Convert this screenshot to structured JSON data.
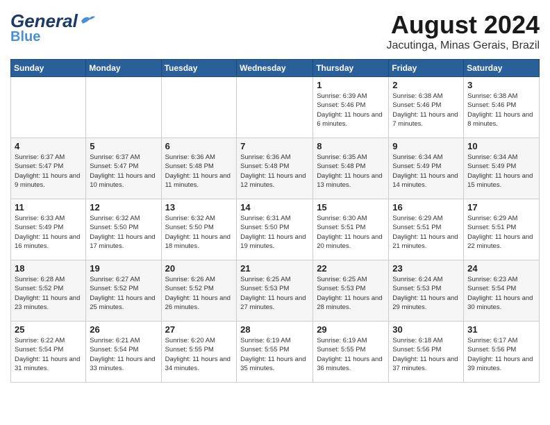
{
  "header": {
    "logo_line1": "General",
    "logo_line2": "Blue",
    "month_year": "August 2024",
    "location": "Jacutinga, Minas Gerais, Brazil"
  },
  "days_of_week": [
    "Sunday",
    "Monday",
    "Tuesday",
    "Wednesday",
    "Thursday",
    "Friday",
    "Saturday"
  ],
  "weeks": [
    [
      {
        "day": "",
        "info": ""
      },
      {
        "day": "",
        "info": ""
      },
      {
        "day": "",
        "info": ""
      },
      {
        "day": "",
        "info": ""
      },
      {
        "day": "1",
        "info": "Sunrise: 6:39 AM\nSunset: 5:46 PM\nDaylight: 11 hours and 6 minutes."
      },
      {
        "day": "2",
        "info": "Sunrise: 6:38 AM\nSunset: 5:46 PM\nDaylight: 11 hours and 7 minutes."
      },
      {
        "day": "3",
        "info": "Sunrise: 6:38 AM\nSunset: 5:46 PM\nDaylight: 11 hours and 8 minutes."
      }
    ],
    [
      {
        "day": "4",
        "info": "Sunrise: 6:37 AM\nSunset: 5:47 PM\nDaylight: 11 hours and 9 minutes."
      },
      {
        "day": "5",
        "info": "Sunrise: 6:37 AM\nSunset: 5:47 PM\nDaylight: 11 hours and 10 minutes."
      },
      {
        "day": "6",
        "info": "Sunrise: 6:36 AM\nSunset: 5:48 PM\nDaylight: 11 hours and 11 minutes."
      },
      {
        "day": "7",
        "info": "Sunrise: 6:36 AM\nSunset: 5:48 PM\nDaylight: 11 hours and 12 minutes."
      },
      {
        "day": "8",
        "info": "Sunrise: 6:35 AM\nSunset: 5:48 PM\nDaylight: 11 hours and 13 minutes."
      },
      {
        "day": "9",
        "info": "Sunrise: 6:34 AM\nSunset: 5:49 PM\nDaylight: 11 hours and 14 minutes."
      },
      {
        "day": "10",
        "info": "Sunrise: 6:34 AM\nSunset: 5:49 PM\nDaylight: 11 hours and 15 minutes."
      }
    ],
    [
      {
        "day": "11",
        "info": "Sunrise: 6:33 AM\nSunset: 5:49 PM\nDaylight: 11 hours and 16 minutes."
      },
      {
        "day": "12",
        "info": "Sunrise: 6:32 AM\nSunset: 5:50 PM\nDaylight: 11 hours and 17 minutes."
      },
      {
        "day": "13",
        "info": "Sunrise: 6:32 AM\nSunset: 5:50 PM\nDaylight: 11 hours and 18 minutes."
      },
      {
        "day": "14",
        "info": "Sunrise: 6:31 AM\nSunset: 5:50 PM\nDaylight: 11 hours and 19 minutes."
      },
      {
        "day": "15",
        "info": "Sunrise: 6:30 AM\nSunset: 5:51 PM\nDaylight: 11 hours and 20 minutes."
      },
      {
        "day": "16",
        "info": "Sunrise: 6:29 AM\nSunset: 5:51 PM\nDaylight: 11 hours and 21 minutes."
      },
      {
        "day": "17",
        "info": "Sunrise: 6:29 AM\nSunset: 5:51 PM\nDaylight: 11 hours and 22 minutes."
      }
    ],
    [
      {
        "day": "18",
        "info": "Sunrise: 6:28 AM\nSunset: 5:52 PM\nDaylight: 11 hours and 23 minutes."
      },
      {
        "day": "19",
        "info": "Sunrise: 6:27 AM\nSunset: 5:52 PM\nDaylight: 11 hours and 25 minutes."
      },
      {
        "day": "20",
        "info": "Sunrise: 6:26 AM\nSunset: 5:52 PM\nDaylight: 11 hours and 26 minutes."
      },
      {
        "day": "21",
        "info": "Sunrise: 6:25 AM\nSunset: 5:53 PM\nDaylight: 11 hours and 27 minutes."
      },
      {
        "day": "22",
        "info": "Sunrise: 6:25 AM\nSunset: 5:53 PM\nDaylight: 11 hours and 28 minutes."
      },
      {
        "day": "23",
        "info": "Sunrise: 6:24 AM\nSunset: 5:53 PM\nDaylight: 11 hours and 29 minutes."
      },
      {
        "day": "24",
        "info": "Sunrise: 6:23 AM\nSunset: 5:54 PM\nDaylight: 11 hours and 30 minutes."
      }
    ],
    [
      {
        "day": "25",
        "info": "Sunrise: 6:22 AM\nSunset: 5:54 PM\nDaylight: 11 hours and 31 minutes."
      },
      {
        "day": "26",
        "info": "Sunrise: 6:21 AM\nSunset: 5:54 PM\nDaylight: 11 hours and 33 minutes."
      },
      {
        "day": "27",
        "info": "Sunrise: 6:20 AM\nSunset: 5:55 PM\nDaylight: 11 hours and 34 minutes."
      },
      {
        "day": "28",
        "info": "Sunrise: 6:19 AM\nSunset: 5:55 PM\nDaylight: 11 hours and 35 minutes."
      },
      {
        "day": "29",
        "info": "Sunrise: 6:19 AM\nSunset: 5:55 PM\nDaylight: 11 hours and 36 minutes."
      },
      {
        "day": "30",
        "info": "Sunrise: 6:18 AM\nSunset: 5:56 PM\nDaylight: 11 hours and 37 minutes."
      },
      {
        "day": "31",
        "info": "Sunrise: 6:17 AM\nSunset: 5:56 PM\nDaylight: 11 hours and 39 minutes."
      }
    ]
  ]
}
